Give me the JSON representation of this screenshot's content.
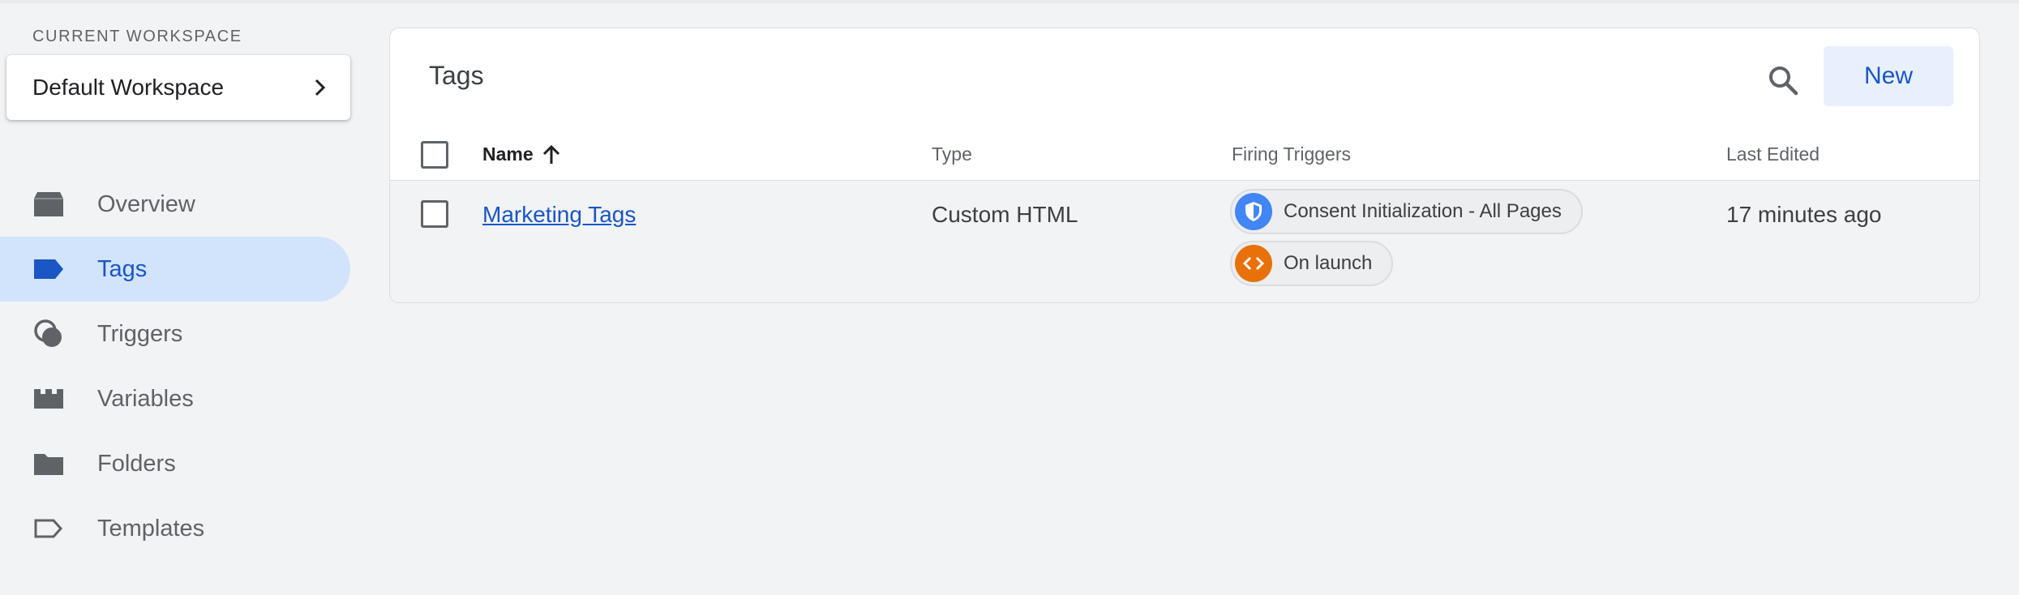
{
  "sidebar": {
    "workspace_label": "CURRENT WORKSPACE",
    "workspace_name": "Default Workspace",
    "items": [
      {
        "label": "Overview",
        "icon": "overview-icon",
        "active": false
      },
      {
        "label": "Tags",
        "icon": "tag-icon",
        "active": true
      },
      {
        "label": "Triggers",
        "icon": "trigger-icon",
        "active": false
      },
      {
        "label": "Variables",
        "icon": "variable-icon",
        "active": false
      },
      {
        "label": "Folders",
        "icon": "folder-icon",
        "active": false
      },
      {
        "label": "Templates",
        "icon": "template-icon",
        "active": false
      }
    ]
  },
  "main": {
    "title": "Tags",
    "new_label": "New",
    "columns": {
      "name": "Name",
      "type": "Type",
      "triggers": "Firing Triggers",
      "edited": "Last Edited"
    },
    "rows": [
      {
        "name": "Marketing Tags",
        "type": "Custom HTML",
        "triggers": [
          {
            "label": "Consent Initialization - All Pages",
            "icon": "shield-icon",
            "color": "#4285f4"
          },
          {
            "label": "On launch",
            "icon": "code-icon",
            "color": "#e8710a"
          }
        ],
        "edited": "17 minutes ago"
      }
    ]
  },
  "colors": {
    "accent": "#1a56c4",
    "active_nav_bg": "#d2e3fc",
    "new_button_bg": "#e8f0fe"
  }
}
